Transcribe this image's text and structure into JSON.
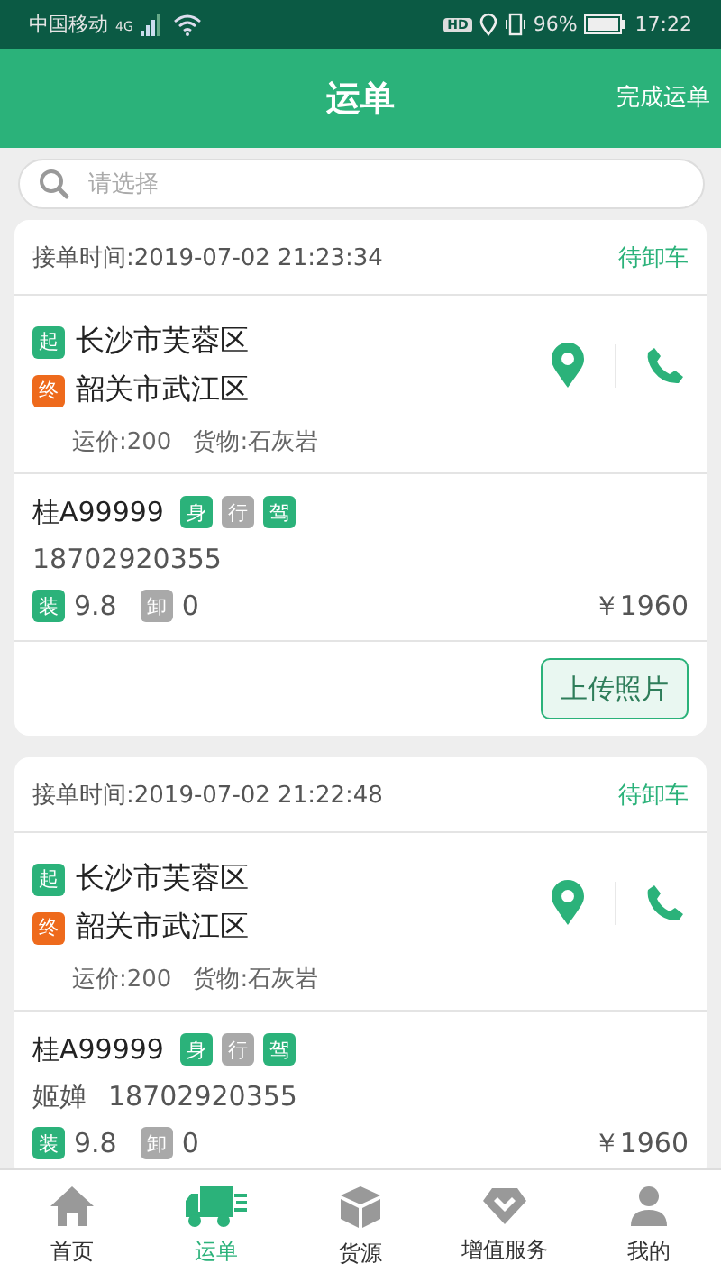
{
  "status_bar": {
    "carrier": "中国移动",
    "network": "4G",
    "hd": "HD",
    "battery": "96%",
    "time": "17:22"
  },
  "header": {
    "title": "运单",
    "action": "完成运单"
  },
  "search": {
    "placeholder": "请选择"
  },
  "orders": [
    {
      "time": "接单时间:2019-07-02 21:23:34",
      "status": "待卸车",
      "stops": [
        {
          "kind": "start",
          "tag": "起",
          "place": "长沙市芙蓉区"
        },
        {
          "kind": "end",
          "tag": "终",
          "place": "韶关市武江区"
        }
      ],
      "freight": "运价:200",
      "cargo": "货物:石灰岩",
      "plate": "桂A99999",
      "docs": [
        {
          "label": "身",
          "verified": true
        },
        {
          "label": "行",
          "verified": false
        },
        {
          "label": "驾",
          "verified": true
        }
      ],
      "phone": "18702920355",
      "load": {
        "label": "装",
        "done": true,
        "value": "9.8"
      },
      "unload": {
        "label": "卸",
        "done": false,
        "value": "0"
      },
      "price": "￥1960",
      "upload_button": "上传照片"
    },
    {
      "time": "接单时间:2019-07-02 21:22:48",
      "status": "待卸车",
      "stops": [
        {
          "kind": "start",
          "tag": "起",
          "place": "长沙市芙蓉区"
        },
        {
          "kind": "end",
          "tag": "终",
          "place": "韶关市武江区"
        }
      ],
      "freight": "运价:200",
      "cargo": "货物:石灰岩",
      "plate": "桂A99999",
      "docs": [
        {
          "label": "身",
          "verified": true
        },
        {
          "label": "行",
          "verified": false
        },
        {
          "label": "驾",
          "verified": true
        }
      ],
      "driver": "姬婵",
      "phone": "18702920355",
      "load": {
        "label": "装",
        "done": true,
        "value": "9.8"
      },
      "unload": {
        "label": "卸",
        "done": false,
        "value": "0"
      },
      "price": "￥1960"
    }
  ],
  "nav": [
    {
      "kind": "home",
      "label": "首页",
      "selected": false
    },
    {
      "kind": "truck",
      "label": "运单",
      "selected": true
    },
    {
      "kind": "box",
      "label": "货源",
      "selected": false
    },
    {
      "kind": "diamond",
      "label": "增值服务",
      "selected": false
    },
    {
      "kind": "person",
      "label": "我的",
      "selected": false
    }
  ]
}
